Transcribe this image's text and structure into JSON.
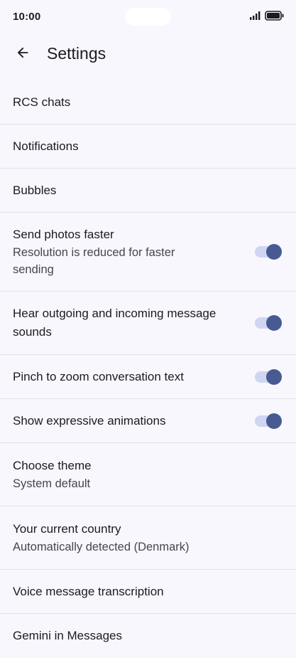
{
  "status_bar": {
    "time": "10:00",
    "icons": [
      "signal-icon",
      "battery-icon"
    ]
  },
  "app_bar": {
    "title": "Settings",
    "back_icon": "arrow-back-icon"
  },
  "colors": {
    "background": "#f7f7fd",
    "toggle_thumb": "#485a92",
    "toggle_track": "#cfd6f2",
    "divider": "#e1e1e8"
  },
  "settings": {
    "rcs_chats": {
      "title": "RCS chats"
    },
    "notifications": {
      "title": "Notifications"
    },
    "bubbles": {
      "title": "Bubbles"
    },
    "send_photos_faster": {
      "title": "Send photos faster",
      "subtitle": "Resolution is reduced for faster sending",
      "enabled": true
    },
    "message_sounds": {
      "title": "Hear outgoing and incoming message sounds",
      "enabled": true
    },
    "pinch_to_zoom": {
      "title": "Pinch to zoom conversation text",
      "enabled": true
    },
    "expressive_animations": {
      "title": "Show expressive animations",
      "enabled": true
    },
    "choose_theme": {
      "title": "Choose theme",
      "subtitle": "System default"
    },
    "current_country": {
      "title": "Your current country",
      "subtitle": "Automatically detected (Denmark)"
    },
    "voice_transcription": {
      "title": "Voice message transcription"
    },
    "gemini": {
      "title": "Gemini in Messages"
    }
  }
}
